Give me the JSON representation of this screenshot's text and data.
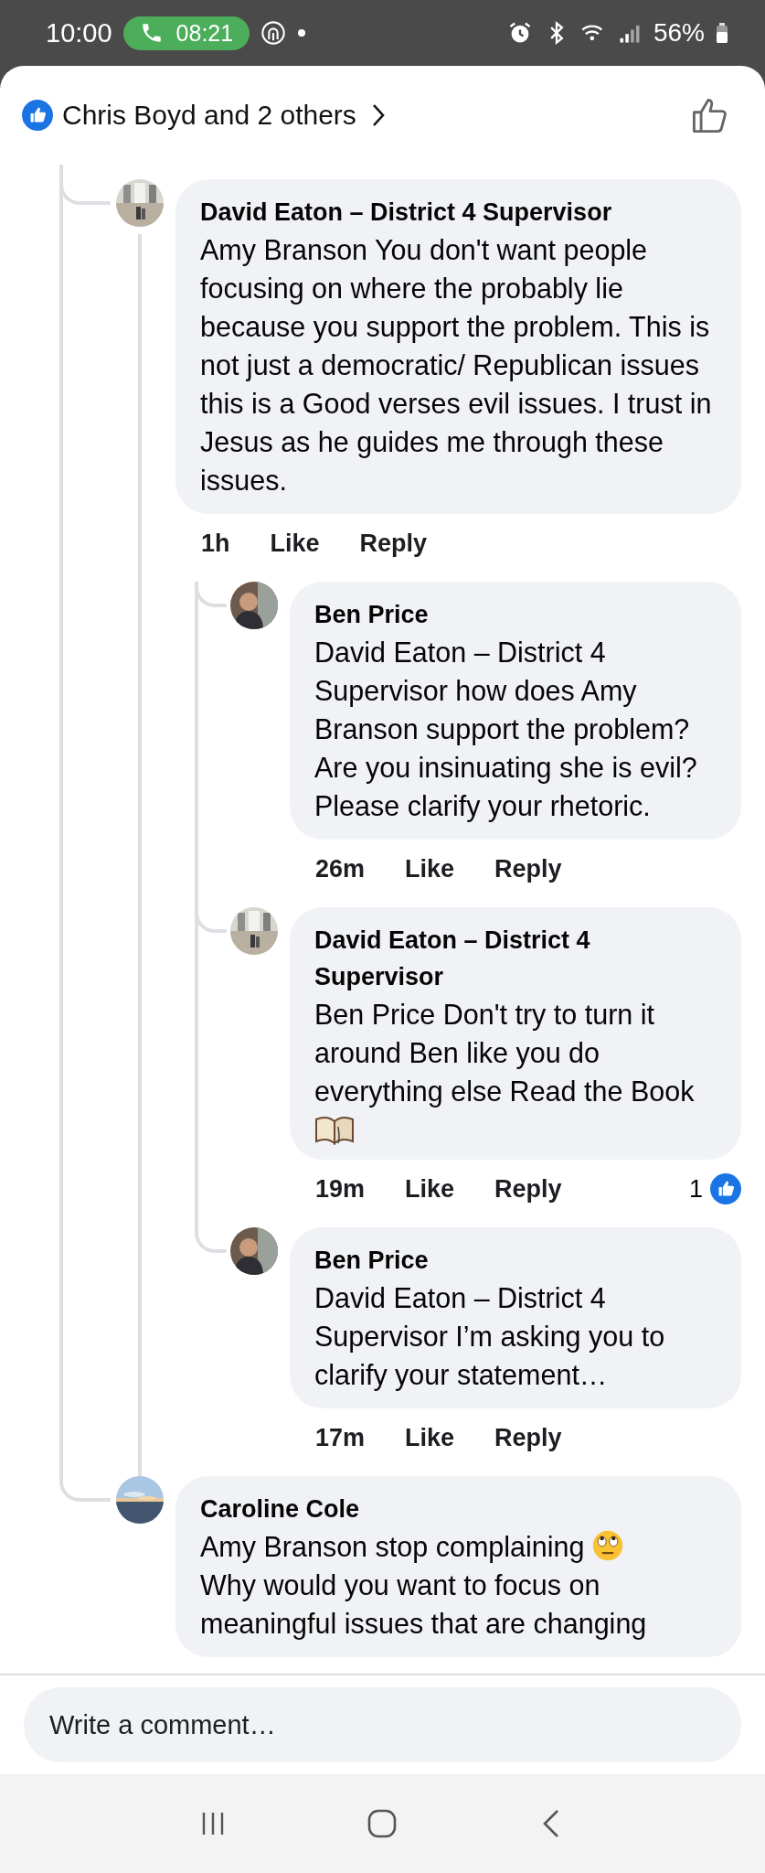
{
  "status_bar": {
    "time": "10:00",
    "call_timer": "08:21",
    "battery": "56%"
  },
  "reactions_header": {
    "summary": "Chris Boyd and 2 others"
  },
  "comments": [
    {
      "author": "David Eaton – District 4 Supervisor",
      "text": "Amy Branson You don't want people focusing on where the probably lie because you support the problem. This is not just a democratic/ Republican issues this is a Good verses evil issues. I trust in Jesus as he guides me through these issues.",
      "kind": "plain",
      "time": "1h",
      "like": "Like",
      "reply": "Reply",
      "replies": [
        {
          "author": "Ben Price",
          "kind": "plain",
          "text": "David Eaton – District 4 Supervisor how does Amy Branson support the problem? Are you insinuating she is evil? Please clarify your rhetoric.",
          "time": "26m",
          "like": "Like",
          "reply": "Reply"
        },
        {
          "author": "David Eaton – District 4 Supervisor",
          "text": "Ben Price Don't try to turn it around Ben like you do everything else Read the Book",
          "kind": "book-emoji",
          "time": "19m",
          "like": "Like",
          "reply": "Reply",
          "like_count": "1"
        },
        {
          "author": "Ben Price",
          "kind": "plain",
          "text": "David Eaton – District 4 Supervisor I’m asking you to clarify your statement…",
          "time": "17m",
          "like": "Like",
          "reply": "Reply"
        }
      ]
    },
    {
      "author": "Caroline Cole",
      "text": "Amy Branson stop complaining",
      "kind": "eye-roll-emoji",
      "text_after": "Why would you want to focus on meaningful issues that are changing"
    }
  ],
  "comment_box": {
    "placeholder": "Write a comment…"
  }
}
